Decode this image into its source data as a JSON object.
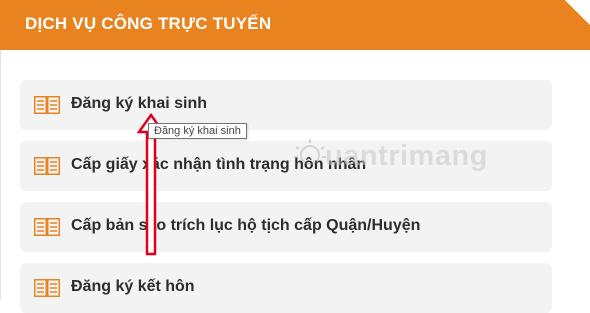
{
  "header": {
    "title": "DỊCH VỤ CÔNG TRỰC TUYẾN",
    "color": "#e8831f"
  },
  "services": [
    {
      "label": "Đăng ký khai sinh",
      "icon": "book-icon"
    },
    {
      "label": "Cấp giấy xác nhận tình trạng hôn nhân",
      "icon": "book-icon"
    },
    {
      "label": "Cấp bản sao trích lục hộ tịch cấp Quận/Huyện",
      "icon": "book-icon"
    },
    {
      "label": "Đăng ký kết hôn",
      "icon": "book-icon"
    }
  ],
  "tooltip": {
    "text": "Đăng ký khai sinh"
  },
  "annotation": {
    "arrow_color": "#e0001b"
  },
  "watermark": {
    "text": "uantrimang"
  }
}
